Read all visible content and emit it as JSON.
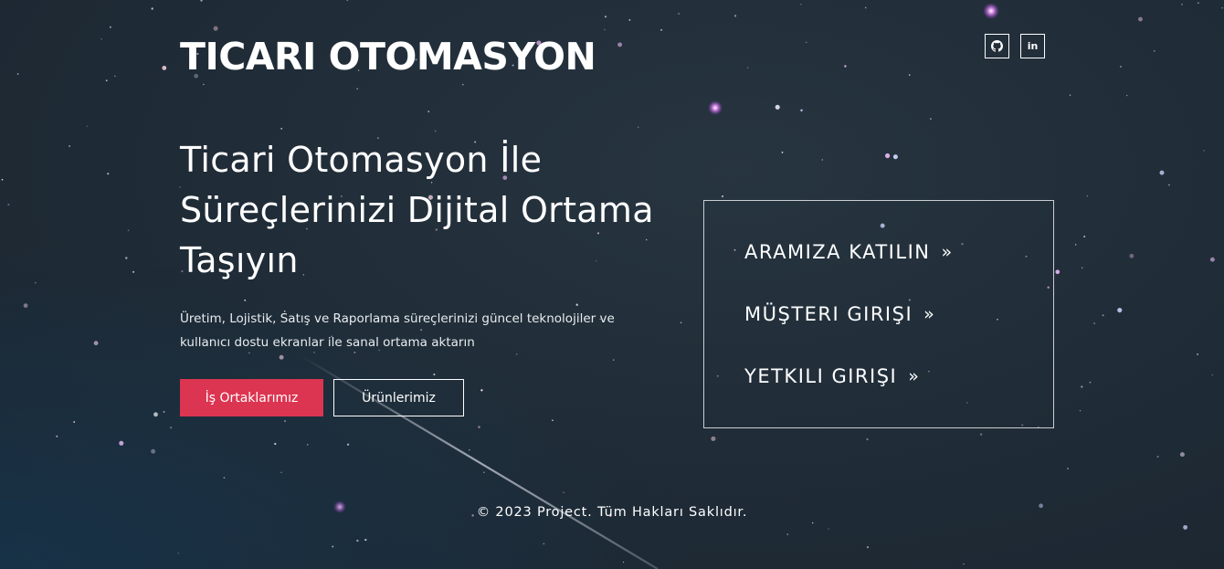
{
  "brand": {
    "title": "TICARI OTOMASYON"
  },
  "social": [
    {
      "name": "github-icon"
    },
    {
      "name": "linkedin-icon",
      "text": "in"
    }
  ],
  "hero": {
    "headline_line1": "Ticari Otomasyon İle",
    "headline_line2": "Süreçlerinizi Dijital Ortama",
    "headline_line3": "Taşıyın",
    "subtitle_line1": "Üretim, Lojistik, Satış ve Raporlama süreçlerinizi güncel teknolojiler ve",
    "subtitle_line2": "kullanıcı dostu ekranlar ile sanal ortama aktarın",
    "primary_button": "İş Ortaklarımız",
    "secondary_button": "Ürünlerimiz"
  },
  "login_panel": {
    "items": [
      {
        "label": "ARAMIZA KATILIN",
        "chevron": "»"
      },
      {
        "label": "MÜŞTERI GIRIŞI",
        "chevron": "»"
      },
      {
        "label": "YETKILI GIRIŞI",
        "chevron": "»"
      }
    ]
  },
  "footer": {
    "text": "© 2023 Project. Tüm Hakları Saklıdır."
  },
  "colors": {
    "background": "#1f2b36",
    "accent": "#dc3551",
    "text": "#ffffff",
    "star_glow": "#c56bd8"
  }
}
